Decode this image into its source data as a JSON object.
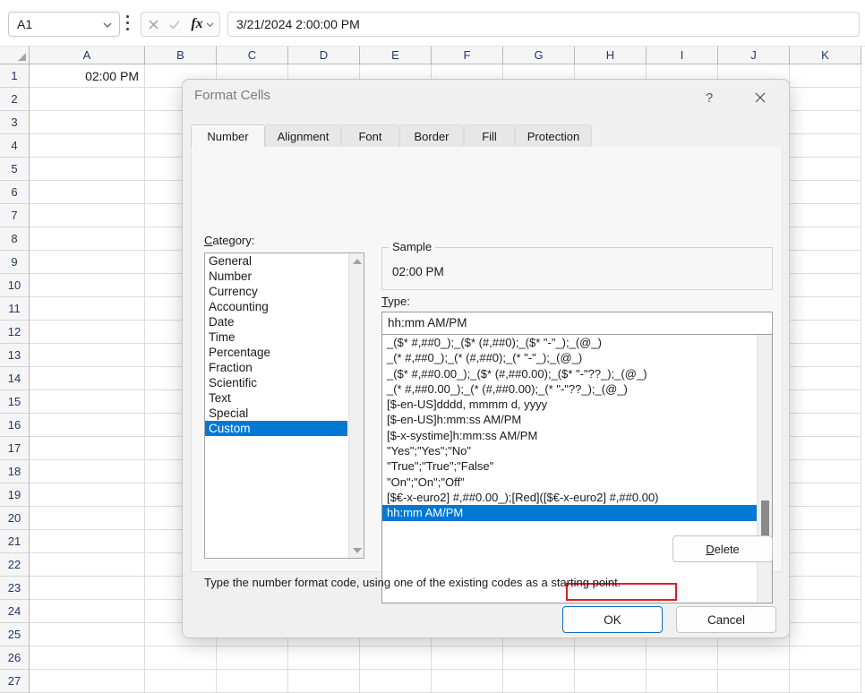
{
  "formula_bar": {
    "name_box_value": "A1",
    "name_box_icon": "chevron-down-icon",
    "kebab_icon": "more-options-icon",
    "cancel_icon": "cancel-x-icon",
    "enter_icon": "enter-check-icon",
    "insert_function_label": "fx",
    "insert_function_icon": "chevron-down-icon",
    "formula_value": "3/21/2024 2:00:00 PM"
  },
  "grid": {
    "columns": [
      "A",
      "B",
      "C",
      "D",
      "E",
      "F",
      "G",
      "H",
      "I",
      "J",
      "K"
    ],
    "rows": [
      "1",
      "2",
      "3",
      "4",
      "5",
      "6",
      "7",
      "8",
      "9",
      "10",
      "11",
      "12",
      "13",
      "14",
      "15",
      "16",
      "17",
      "18",
      "19",
      "20",
      "21",
      "22",
      "23",
      "24",
      "25",
      "26",
      "27"
    ],
    "cells": [
      {
        "row": 1,
        "col": "A",
        "value": "02:00 PM"
      }
    ]
  },
  "dialog": {
    "title": "Format Cells",
    "help_glyph": "?",
    "close_icon": "close-icon",
    "tabs": [
      {
        "label": "Number",
        "active": true
      },
      {
        "label": "Alignment",
        "active": false
      },
      {
        "label": "Font",
        "active": false
      },
      {
        "label": "Border",
        "active": false
      },
      {
        "label": "Fill",
        "active": false
      },
      {
        "label": "Protection",
        "active": false
      }
    ],
    "category": {
      "label_prefix": "C",
      "label_rest": "ategory:",
      "items": [
        {
          "label": "General",
          "selected": false
        },
        {
          "label": "Number",
          "selected": false
        },
        {
          "label": "Currency",
          "selected": false
        },
        {
          "label": "Accounting",
          "selected": false
        },
        {
          "label": "Date",
          "selected": false
        },
        {
          "label": "Time",
          "selected": false
        },
        {
          "label": "Percentage",
          "selected": false
        },
        {
          "label": "Fraction",
          "selected": false
        },
        {
          "label": "Scientific",
          "selected": false
        },
        {
          "label": "Text",
          "selected": false
        },
        {
          "label": "Special",
          "selected": false
        },
        {
          "label": "Custom",
          "selected": true
        }
      ],
      "scroll_up_icon": "triangle-up-icon",
      "scroll_down_icon": "triangle-down-icon"
    },
    "sample": {
      "legend": "Sample",
      "value": "02:00 PM"
    },
    "type": {
      "label_prefix": "T",
      "label_rest": "ype:",
      "value": "hh:mm AM/PM"
    },
    "format_codes": {
      "items": [
        {
          "code": "_($* #,##0_);_($* (#,##0);_($* \"-\"_);_(@_)",
          "selected": false
        },
        {
          "code": "_(* #,##0_);_(* (#,##0);_(* \"-\"_);_(@_)",
          "selected": false
        },
        {
          "code": "_($* #,##0.00_);_($* (#,##0.00);_($* \"-\"??_);_(@_)",
          "selected": false
        },
        {
          "code": "_(* #,##0.00_);_(* (#,##0.00);_(* \"-\"??_);_(@_)",
          "selected": false
        },
        {
          "code": "[$-en-US]dddd, mmmm d, yyyy",
          "selected": false
        },
        {
          "code": "[$-en-US]h:mm:ss AM/PM",
          "selected": false
        },
        {
          "code": "[$-x-systime]h:mm:ss AM/PM",
          "selected": false
        },
        {
          "code": "\"Yes\";\"Yes\";\"No\"",
          "selected": false
        },
        {
          "code": "\"True\";\"True\";\"False\"",
          "selected": false
        },
        {
          "code": "\"On\";\"On\";\"Off\"",
          "selected": false
        },
        {
          "code": "[$€-x-euro2] #,##0.00_);[Red]([$€-x-euro2] #,##0.00)",
          "selected": false
        },
        {
          "code": "hh:mm AM/PM",
          "selected": true
        }
      ],
      "annotation_color": "#e01b24"
    },
    "delete_button": {
      "label_prefix": "D",
      "label_rest": "elete"
    },
    "helper_text": "Type the number format code, using one of the existing codes as a starting point.",
    "ok_label": "OK",
    "cancel_label": "Cancel"
  },
  "colors": {
    "selection_blue": "#0078d4",
    "annotation_red": "#e01b24",
    "ok_border": "#0f6cbd"
  }
}
